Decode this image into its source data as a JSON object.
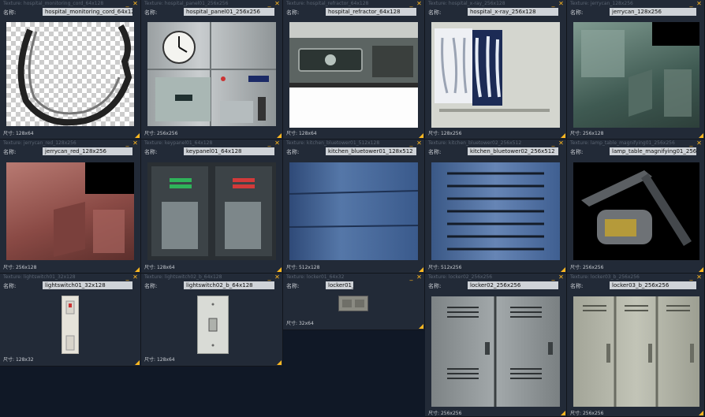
{
  "ui": {
    "min_symbol": "_",
    "close_symbol": "✕",
    "name_label": "名称:",
    "size_label": "尺寸:",
    "accent": "#ffb820"
  },
  "tiles": [
    {
      "header": "Texture: hospital_monitoring_cord_64x128",
      "name": "hospital_monitoring_cord_64x128",
      "size": "128x64"
    },
    {
      "header": "Texture: hospital_panel01_256x256",
      "name": "hospital_panel01_256x256",
      "size": "256x256"
    },
    {
      "header": "Texture: hospital_refractor_64x128",
      "name": "hospital_refractor_64x128",
      "size": "128x64"
    },
    {
      "header": "Texture: hospital_x-ray_256x128",
      "name": "hospital_x-ray_256x128",
      "size": "128x256"
    },
    {
      "header": "Texture: jerrycan_128x256",
      "name": "jerrycan_128x256",
      "size": "256x128"
    },
    {
      "header": "Texture: jerrycan_red_128x256",
      "name": "jerrycan_red_128x256",
      "size": "256x128"
    },
    {
      "header": "Texture: keypanel01_64x128",
      "name": "keypanel01_64x128",
      "size": "128x64"
    },
    {
      "header": "Texture: kitchen_bluetower01_512x128",
      "name": "kitchen_bluetower01_128x512",
      "size": "512x128"
    },
    {
      "header": "Texture: kitchen_bluetower02_256x512",
      "name": "kitchen_bluetower02_256x512",
      "size": "512x256"
    },
    {
      "header": "Texture: lamp_table_magnifying01_256x256",
      "name": "lamp_table_magnifying01_256x256",
      "size": "256x256"
    },
    {
      "header": "Texture: lightswitch01_32x128",
      "name": "lightswitch01_32x128",
      "size": "128x32"
    },
    {
      "header": "Texture: lightswitch02_b_64x128",
      "name": "lightswitch02_b_64x128",
      "size": "128x64"
    },
    {
      "header": "Texture: locker01_64x32",
      "name": "locker01_64x32",
      "size": "32x64"
    },
    {
      "header": "Texture: locker02_256x256",
      "name": "locker02_256x256",
      "size": "256x256"
    },
    {
      "header": "Texture: locker03_b_256x256",
      "name": "locker03_b_256x256",
      "size": "256x256"
    }
  ]
}
